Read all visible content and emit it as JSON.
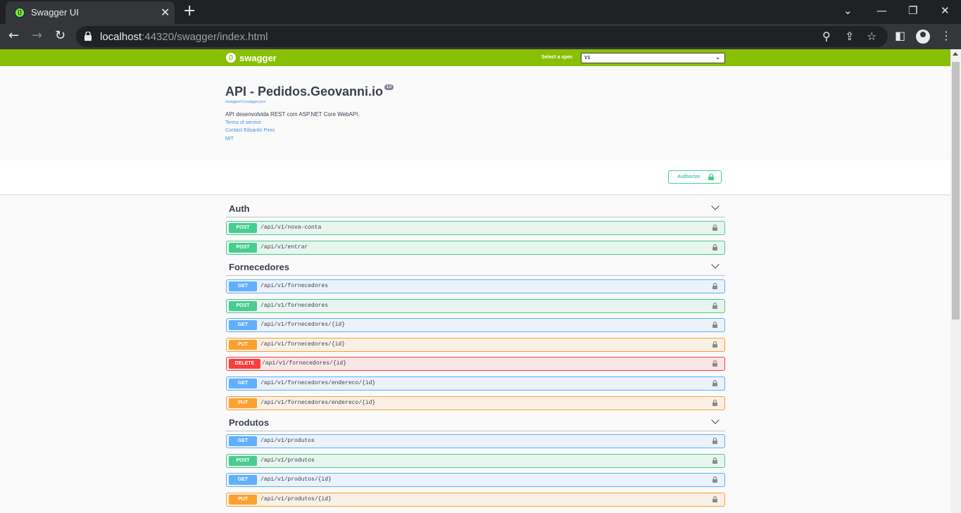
{
  "browser": {
    "tab_title": "Swagger UI",
    "url_host": "localhost",
    "url_rest": ":44320/swagger/index.html"
  },
  "topbar": {
    "brand": "swagger",
    "spec_label": "Select a spec",
    "spec_value": "V1"
  },
  "info": {
    "title": "API - Pedidos.Geovanni.io",
    "version": "1.0",
    "spec_url": "/swagger/v1/swagger.json",
    "description": "API desenvolvida REST com ASP.NET Core WebAPI.",
    "terms": "Terms of service",
    "contact": "Contact Eduardo Pires",
    "license": "MIT"
  },
  "authorize_label": "Authorize",
  "sections": [
    {
      "name": "Auth",
      "ops": [
        {
          "method": "POST",
          "path": "/api/v1/nova-conta"
        },
        {
          "method": "POST",
          "path": "/api/v1/entrar"
        }
      ]
    },
    {
      "name": "Fornecedores",
      "ops": [
        {
          "method": "GET",
          "path": "/api/v1/fornecedores"
        },
        {
          "method": "POST",
          "path": "/api/v1/fornecedores"
        },
        {
          "method": "GET",
          "path": "/api/v1/fornecedores/{id}"
        },
        {
          "method": "PUT",
          "path": "/api/v1/fornecedores/{id}"
        },
        {
          "method": "DELETE",
          "path": "/api/v1/fornecedores/{id}"
        },
        {
          "method": "GET",
          "path": "/api/v1/fornecedores/endereco/{id}"
        },
        {
          "method": "PUT",
          "path": "/api/v1/fornecedores/endereco/{id}"
        }
      ]
    },
    {
      "name": "Produtos",
      "ops": [
        {
          "method": "GET",
          "path": "/api/v1/produtos"
        },
        {
          "method": "POST",
          "path": "/api/v1/produtos"
        },
        {
          "method": "GET",
          "path": "/api/v1/produtos/{id}"
        },
        {
          "method": "PUT",
          "path": "/api/v1/produtos/{id}"
        }
      ]
    }
  ],
  "colors": {
    "topbar": "#89bf04",
    "get": "#61affe",
    "post": "#49cc90",
    "put": "#fca130",
    "delete": "#f93e3e"
  }
}
